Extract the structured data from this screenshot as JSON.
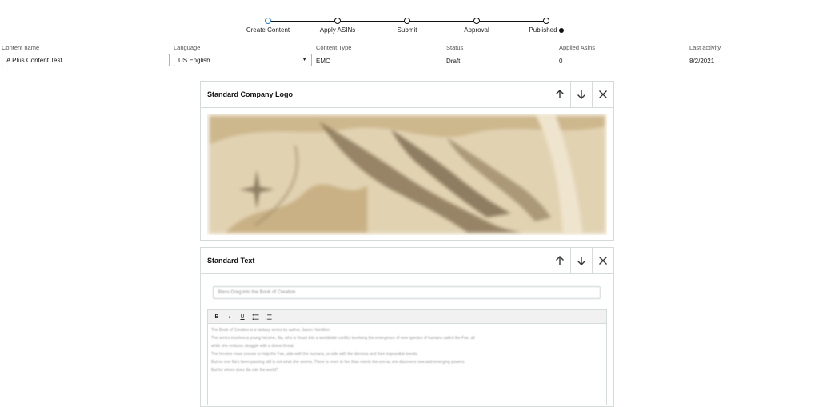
{
  "stepper": {
    "steps": [
      {
        "label": "Create Content",
        "active": true
      },
      {
        "label": "Apply ASINs",
        "active": false
      },
      {
        "label": "Submit",
        "active": false
      },
      {
        "label": "Approval",
        "active": false
      },
      {
        "label": "Published",
        "active": false,
        "info_icon": "info-icon"
      }
    ]
  },
  "info": {
    "content_name": {
      "label": "Content name",
      "value": "A Plus Content Test"
    },
    "language": {
      "label": "Language",
      "value": "US English"
    },
    "content_type": {
      "label": "Content Type",
      "value": "EMC"
    },
    "status": {
      "label": "Status",
      "value": "Draft"
    },
    "applied_asins": {
      "label": "Applied Asins",
      "value": "0"
    },
    "last_activity": {
      "label": "Last activity",
      "value": "8/2/2021"
    }
  },
  "modules": [
    {
      "title": "Standard Company Logo",
      "controls": [
        "arrow-up-icon",
        "arrow-down-icon",
        "close-icon"
      ],
      "image": "parchment-map-logo"
    },
    {
      "title": "Standard Text",
      "controls": [
        "arrow-up-icon",
        "arrow-down-icon",
        "close-icon"
      ],
      "headline": "Bless Greg into the Book of Creation",
      "toolbar": [
        "B",
        "I",
        "U",
        "bulleted-list-icon",
        "numbered-list-icon"
      ],
      "body_lines": [
        "The Book of Creation is a fantasy series by author, Jason Hamilton.",
        "The series involves a young heroine, Ilia, who is thrust into a worldwide conflict involving the emergence of new species of humans called the Fae, all",
        "while she endures struggle with a divine threat.",
        "The heroine must choose to help the Fae, side with the humans, or side with the demons and their impossible bonds.",
        "But no one Ilia's been passing still is not what she seems. There is more to her than meets the eye as she discovers new and emerging powers.",
        "But for whom does Ilia rule the world?"
      ]
    }
  ],
  "colors": {
    "active_step": "#2a7db8",
    "border": "#d5dbdb",
    "parchment": "#d8c6a2"
  }
}
